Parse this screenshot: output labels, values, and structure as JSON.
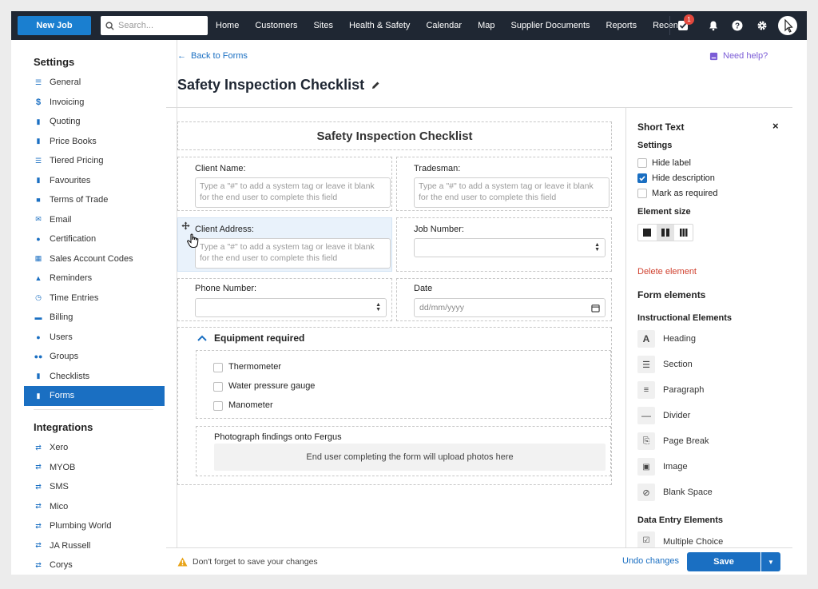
{
  "topnav": {
    "new_job_label": "New Job",
    "search_placeholder": "Search...",
    "items": [
      "Home",
      "Customers",
      "Sites",
      "Health & Safety",
      "Calendar",
      "Map",
      "Supplier Documents",
      "Reports",
      "Recent"
    ],
    "notification_count": "1"
  },
  "sidebar": {
    "settings_heading": "Settings",
    "settings_items": [
      {
        "label": "General",
        "icon": "list-icon"
      },
      {
        "label": "Invoicing",
        "icon": "dollar-icon"
      },
      {
        "label": "Quoting",
        "icon": "document-icon"
      },
      {
        "label": "Price Books",
        "icon": "book-icon"
      },
      {
        "label": "Tiered Pricing",
        "icon": "list-icon"
      },
      {
        "label": "Favourites",
        "icon": "bookmark-icon"
      },
      {
        "label": "Terms of Trade",
        "icon": "folder-icon"
      },
      {
        "label": "Email",
        "icon": "envelope-icon"
      },
      {
        "label": "Certification",
        "icon": "circle-icon"
      },
      {
        "label": "Sales Account Codes",
        "icon": "grid-icon"
      },
      {
        "label": "Reminders",
        "icon": "bell-icon"
      },
      {
        "label": "Time Entries",
        "icon": "clock-icon"
      },
      {
        "label": "Billing",
        "icon": "card-icon"
      },
      {
        "label": "Users",
        "icon": "user-icon"
      },
      {
        "label": "Groups",
        "icon": "users-icon"
      },
      {
        "label": "Checklists",
        "icon": "checklist-icon"
      },
      {
        "label": "Forms",
        "icon": "form-icon"
      }
    ],
    "active_item": "Forms",
    "integrations_heading": "Integrations",
    "integration_items": [
      "Xero",
      "MYOB",
      "SMS",
      "Mico",
      "Plumbing World",
      "JA Russell",
      "Corys"
    ]
  },
  "header": {
    "back_label": "Back to Forms",
    "help_label": "Need help?",
    "title": "Safety Inspection Checklist"
  },
  "form": {
    "heading": "Safety Inspection Checklist",
    "client_name_label": "Client Name:",
    "tradesman_label": "Tradesman:",
    "client_address_label": "Client Address:",
    "job_number_label": "Job Number:",
    "phone_number_label": "Phone Number:",
    "date_label": "Date",
    "date_placeholder": "dd/mm/yyyy",
    "tag_placeholder": "Type a \"#\" to add a system tag or leave it blank for the end user to complete this field",
    "equipment_heading": "Equipment required",
    "equipment_items": [
      "Thermometer",
      "Water pressure gauge",
      "Manometer"
    ],
    "photo_label": "Photograph findings onto Fergus",
    "photo_hint": "End user completing the form will upload photos here"
  },
  "panel": {
    "title": "Short Text",
    "settings_heading": "Settings",
    "options": [
      {
        "label": "Hide label",
        "checked": false
      },
      {
        "label": "Hide description",
        "checked": true
      },
      {
        "label": "Mark as required",
        "checked": false
      }
    ],
    "element_size_heading": "Element size",
    "delete_label": "Delete element",
    "form_elements_heading": "Form elements",
    "instructional_heading": "Instructional Elements",
    "instructional_items": [
      {
        "label": "Heading",
        "icon": "heading-icon"
      },
      {
        "label": "Section",
        "icon": "section-icon"
      },
      {
        "label": "Paragraph",
        "icon": "paragraph-icon"
      },
      {
        "label": "Divider",
        "icon": "divider-icon"
      },
      {
        "label": "Page Break",
        "icon": "page-break-icon"
      },
      {
        "label": "Image",
        "icon": "image-icon"
      },
      {
        "label": "Blank Space",
        "icon": "blank-space-icon"
      }
    ],
    "data_entry_heading": "Data Entry Elements",
    "data_entry_items": [
      {
        "label": "Multiple Choice",
        "icon": "checkbox-icon"
      }
    ]
  },
  "footer": {
    "warning": "Don't forget to save your changes",
    "undo_label": "Undo changes",
    "save_label": "Save"
  },
  "colors": {
    "nav_bg": "#1f2733",
    "accent_blue": "#1a6fc2",
    "delete_red": "#d0412f",
    "help_purple": "#7b5cd6",
    "warning_orange": "#e8a317"
  }
}
